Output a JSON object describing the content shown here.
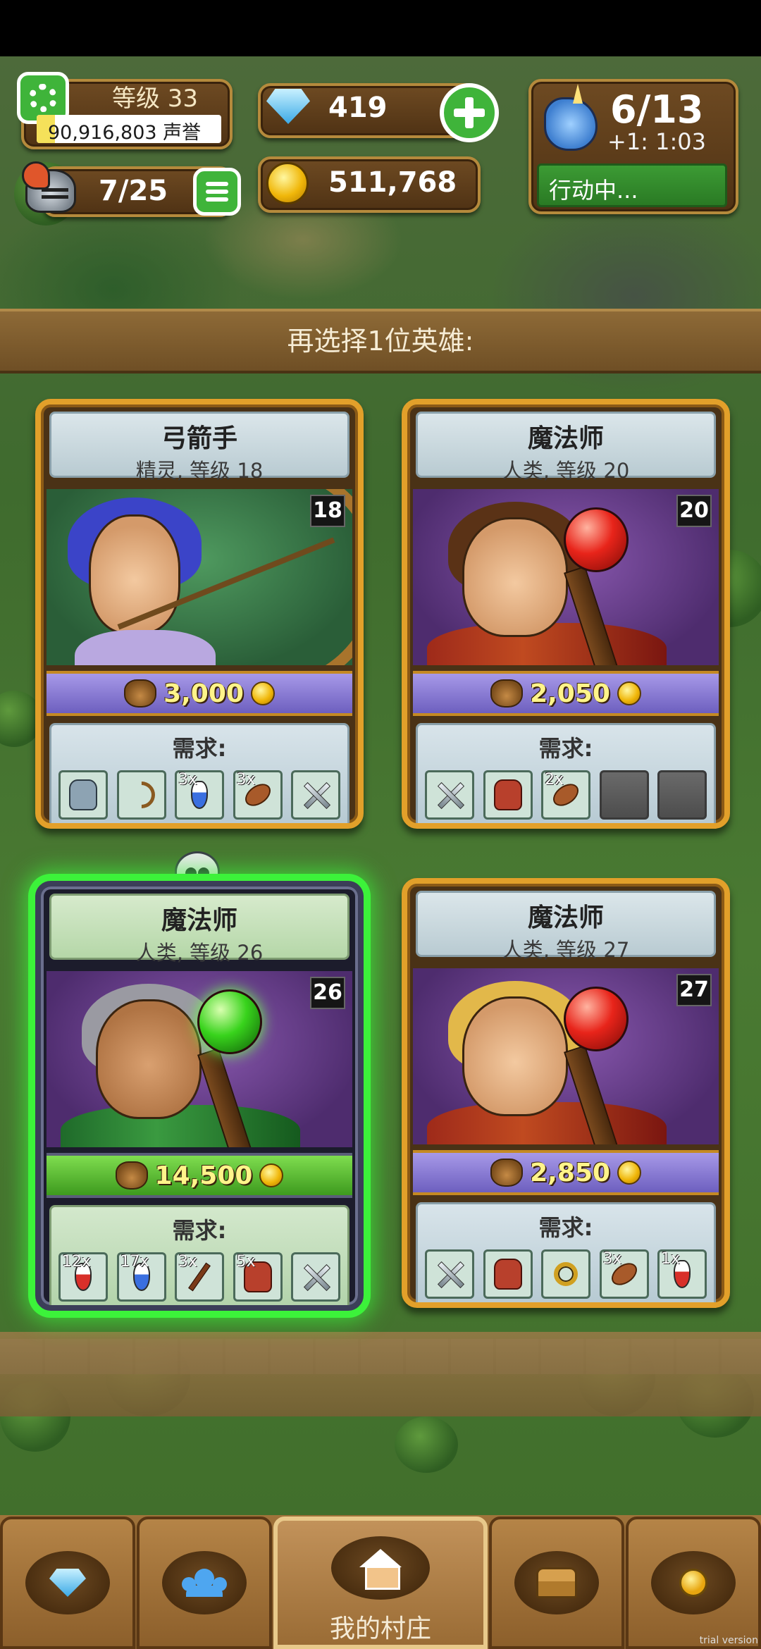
{
  "hud": {
    "level": "等级 33",
    "fame": "90,916,803 声誉",
    "fame_progress": 0.1,
    "heroes": "7/25",
    "gems": "419",
    "gold": "511,768",
    "energy": "6/13",
    "energy_timer": "+1: 1:03",
    "status": "行动中..."
  },
  "banner": "再选择1位英雄:",
  "cards": [
    {
      "class": "弓箭手",
      "info": "精灵, 等级 18",
      "level": "18",
      "price": "3,000",
      "req_title": "需求:",
      "items": [
        {
          "icon": "armor-icon",
          "qty": ""
        },
        {
          "icon": "bow-icon",
          "qty": ""
        },
        {
          "icon": "blue-potion-icon",
          "qty": "3x"
        },
        {
          "icon": "meat-icon",
          "qty": "3x"
        },
        {
          "icon": "swords-icon",
          "qty": ""
        }
      ]
    },
    {
      "class": "魔法师",
      "info": "人类, 等级 20",
      "level": "20",
      "price": "2,050",
      "req_title": "需求:",
      "items": [
        {
          "icon": "swords-icon",
          "qty": ""
        },
        {
          "icon": "red-armor-icon",
          "qty": ""
        },
        {
          "icon": "meat-icon",
          "qty": "2x"
        },
        {
          "icon": "empty-slot",
          "qty": ""
        },
        {
          "icon": "empty-slot",
          "qty": ""
        }
      ]
    },
    {
      "class": "魔法师",
      "info": "人类, 等级 26",
      "level": "26",
      "price": "14,500",
      "req_title": "需求:",
      "items": [
        {
          "icon": "red-potion-icon",
          "qty": "12x"
        },
        {
          "icon": "blue-potion-icon",
          "qty": "17x"
        },
        {
          "icon": "staff-icon",
          "qty": "3x"
        },
        {
          "icon": "red-armor-icon",
          "qty": "5x"
        },
        {
          "icon": "swords-icon",
          "qty": ""
        }
      ]
    },
    {
      "class": "魔法师",
      "info": "人类, 等级 27",
      "level": "27",
      "price": "2,850",
      "req_title": "需求:",
      "items": [
        {
          "icon": "swords-icon",
          "qty": ""
        },
        {
          "icon": "red-armor-icon",
          "qty": ""
        },
        {
          "icon": "ring-icon",
          "qty": ""
        },
        {
          "icon": "meat-icon",
          "qty": "3x"
        },
        {
          "icon": "red-potion-icon",
          "qty": "1x"
        }
      ]
    }
  ],
  "nav": {
    "village_label": "我的村庄"
  },
  "watermark": "trial version"
}
